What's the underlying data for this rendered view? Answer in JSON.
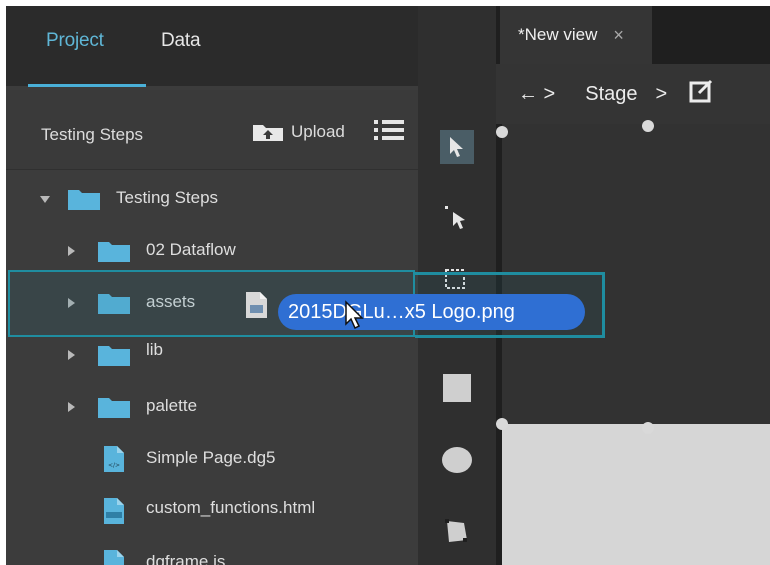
{
  "project_panel": {
    "tabs": [
      {
        "label": "Project",
        "active": true
      },
      {
        "label": "Data",
        "active": false
      }
    ],
    "header": {
      "title": "Testing Steps",
      "upload_label": "Upload"
    },
    "tree": [
      {
        "label": "Testing Steps",
        "type": "folder",
        "expanded": true,
        "depth": 0
      },
      {
        "label": "02 Dataflow",
        "type": "folder",
        "expanded": false,
        "depth": 1
      },
      {
        "label": "assets",
        "type": "folder",
        "expanded": false,
        "depth": 1
      },
      {
        "label": "lib",
        "type": "folder",
        "expanded": false,
        "depth": 1
      },
      {
        "label": "palette",
        "type": "folder",
        "expanded": false,
        "depth": 1
      },
      {
        "label": "Simple Page.dg5",
        "type": "file",
        "icon": "dg5-file-icon",
        "depth": 1
      },
      {
        "label": "custom_functions.html",
        "type": "file",
        "icon": "html-file-icon",
        "depth": 1
      },
      {
        "label": "dgframe.js",
        "type": "file",
        "icon": "js-file-icon",
        "depth": 1
      }
    ]
  },
  "tools": [
    "select-arrow-icon",
    "direct-select-icon",
    "marquee-select-icon",
    "rectangle-tool-icon",
    "ellipse-tool-icon",
    "polygon-tool-icon"
  ],
  "view": {
    "tab_title": "*New view",
    "tab_close": "×",
    "toolbar": {
      "back_forward": "← >",
      "stage_label": "Stage",
      "separator": ">"
    }
  },
  "drag": {
    "file_name": "2015DGLu…x5 Logo.png"
  },
  "colors": {
    "accent": "#4ab0d8",
    "drag_pill": "#2f6fd3",
    "drop_frame": "#1f8da0"
  }
}
